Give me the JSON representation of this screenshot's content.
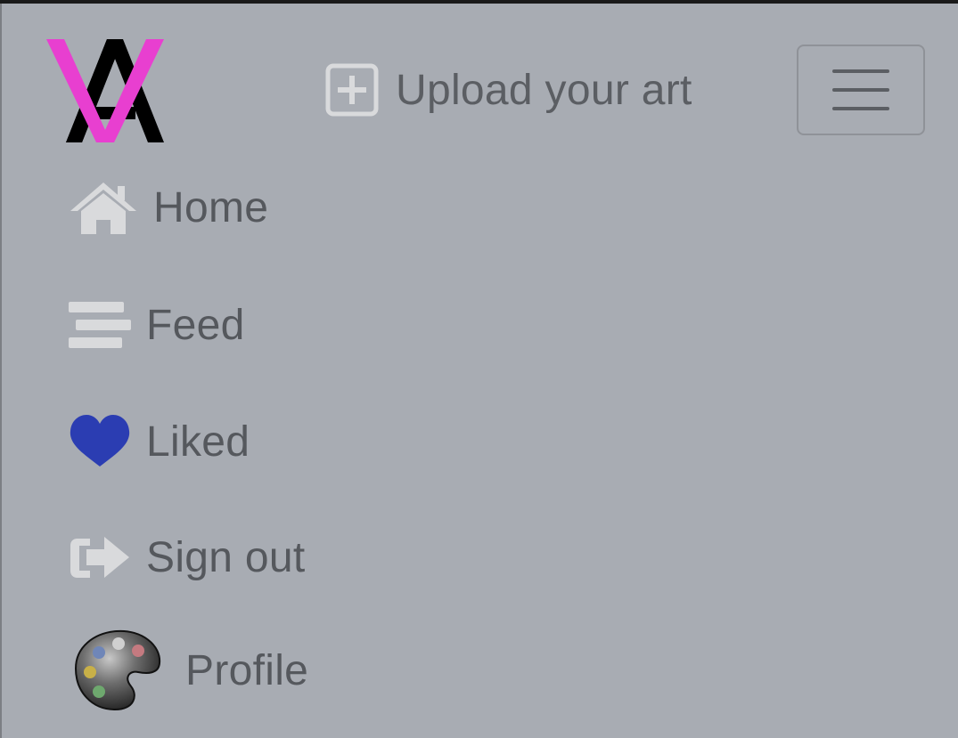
{
  "header": {
    "logo_icon": "va-logo-icon",
    "upload_icon": "plus-square-icon",
    "upload_label": "Upload your art",
    "menu_icon": "hamburger-icon"
  },
  "nav": {
    "items": [
      {
        "label": "Home",
        "icon": "home-icon"
      },
      {
        "label": "Feed",
        "icon": "feed-icon"
      },
      {
        "label": "Liked",
        "icon": "heart-icon"
      },
      {
        "label": "Sign out",
        "icon": "sign-out-icon"
      },
      {
        "label": "Profile",
        "icon": "palette-icon"
      }
    ]
  },
  "colors": {
    "background": "#a8acb3",
    "text": "#55585d",
    "icon_light": "#d9dadc",
    "heart": "#2b3db2",
    "logo_magenta": "#e83fd0",
    "logo_black": "#000000"
  }
}
